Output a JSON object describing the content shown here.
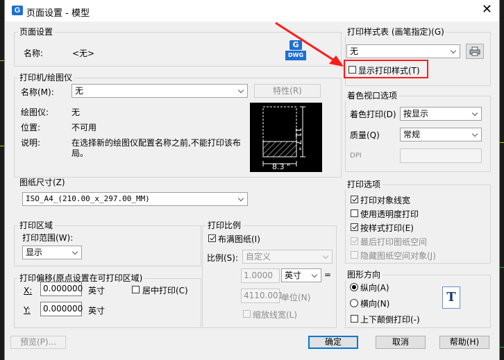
{
  "window": {
    "title": "页面设置 - 模型",
    "app_icon": "G",
    "close": "✕"
  },
  "page_setup": {
    "group": "页面设置",
    "name_label": "名称:",
    "name_value": "<无>",
    "dwg_icon_text": "DWG"
  },
  "printer": {
    "group": "打印机/绘图仪",
    "name_label": "名称(M):",
    "name_value": "无",
    "properties_button": "特性(R)",
    "plotter_label": "绘图仪:",
    "plotter_value": "无",
    "location_label": "位置:",
    "location_value": "不可用",
    "desc_label": "说明:",
    "desc_line1": "在选择新的绘图仪配置名称之前,不能打印该布",
    "desc_line2": "局。",
    "preview_width": "8.3 \"",
    "preview_height": "11.7 \""
  },
  "paper_size": {
    "group": "图纸尺寸(Z)",
    "value": "ISO_A4_(210.00_x_297.00_MM)"
  },
  "plot_area": {
    "group": "打印区域",
    "range_label": "打印范围(W):",
    "range_value": "显示"
  },
  "plot_offset": {
    "group": "打印偏移(原点设置在可打印区域)",
    "x_label": "X:",
    "x_value": "0.000000",
    "x_unit": "英寸",
    "y_label": "Y:",
    "y_value": "0.000000",
    "y_unit": "英寸",
    "center_label": "居中打印(C)"
  },
  "plot_scale": {
    "group": "打印比例",
    "fit_label": "布满图纸(I)",
    "scale_label": "比例(S):",
    "scale_value": "自定义",
    "value1": "1.0000",
    "unit_value": "英寸",
    "equals": "=",
    "value2": "4110.001",
    "unit_label": "单位(N)",
    "lineweight_label": "缩放线宽(L)"
  },
  "plot_style": {
    "group": "打印样式表 (画笔指定)(G)",
    "value": "无",
    "show_label": "显示打印样式(T)"
  },
  "shaded": {
    "group": "着色视口选项",
    "shade_label": "着色打印(D)",
    "shade_value": "按显示",
    "quality_label": "质量(Q)",
    "quality_value": "常规",
    "dpi_label": "DPI"
  },
  "plot_options": {
    "group": "打印选项",
    "lineweights": "打印对象线宽",
    "transparency": "使用透明度打印",
    "by_style": "按样式打印(E)",
    "paperspace_last": "最后打印图纸空间",
    "hide_objects": "隐藏图纸空间对象(J)"
  },
  "orientation": {
    "group": "图形方向",
    "portrait": "纵向(A)",
    "landscape": "横向(N)",
    "upside_down": "上下颠倒打印(-)",
    "icon_letter": "T"
  },
  "footer": {
    "preview": "预览(P)...",
    "ok": "确定",
    "cancel": "取消",
    "help": "帮助(H)"
  },
  "colors": {
    "annotation": "#ff1a1a",
    "accent": "#0078d7"
  }
}
